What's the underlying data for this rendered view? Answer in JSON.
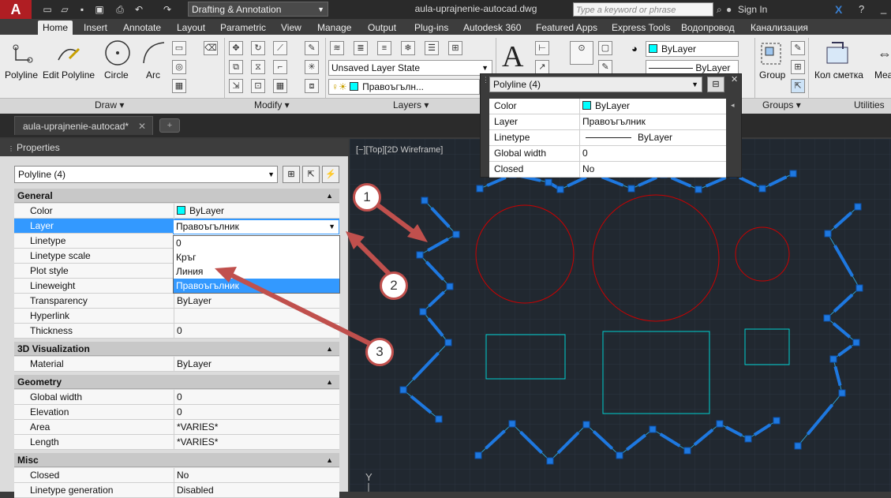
{
  "titlebar": {
    "workspace": "Drafting & Annotation",
    "filename": "aula-uprajnenie-autocad.dwg",
    "search_placeholder": "Type a keyword or phrase",
    "signin": "Sign In"
  },
  "ribbon_tabs": [
    "Home",
    "Insert",
    "Annotate",
    "Layout",
    "Parametric",
    "View",
    "Manage",
    "Output",
    "Plug-ins",
    "Autodesk 360",
    "Featured Apps",
    "Express Tools",
    "Водопровод",
    "Канализация"
  ],
  "ribbon": {
    "draw": {
      "polyline": "Polyline",
      "edit_polyline": "Edit Polyline",
      "circle": "Circle",
      "arc": "Arc",
      "panel": "Draw"
    },
    "modify": {
      "panel": "Modify"
    },
    "layers": {
      "layer_state": "Unsaved Layer State",
      "current_layer": "Правоъгълн...",
      "panel": "Layers"
    },
    "properties": {
      "color": "ByLayer",
      "linetype": "ByLayer"
    },
    "groups": {
      "group": "Group",
      "panel": "Groups"
    },
    "utilities": {
      "kol": "Кол сметка",
      "mea": "Mea",
      "panel": "Utilities"
    }
  },
  "doc_tab": "aula-uprajnenie-autocad*",
  "properties_palette": {
    "title": "Properties",
    "object_select": "Polyline (4)",
    "categories": {
      "general": "General",
      "viz": "3D Visualization",
      "geometry": "Geometry",
      "misc": "Misc"
    },
    "general_rows": [
      {
        "name": "Color",
        "value": "ByLayer"
      },
      {
        "name": "Layer",
        "value": "Правоъгълник"
      },
      {
        "name": "Linetype",
        "value": ""
      },
      {
        "name": "Linetype scale",
        "value": ""
      },
      {
        "name": "Plot style",
        "value": ""
      },
      {
        "name": "Lineweight",
        "value": ""
      },
      {
        "name": "Transparency",
        "value": "ByLayer"
      },
      {
        "name": "Hyperlink",
        "value": ""
      },
      {
        "name": "Thickness",
        "value": "0"
      }
    ],
    "viz_rows": [
      {
        "name": "Material",
        "value": "ByLayer"
      }
    ],
    "geometry_rows": [
      {
        "name": "Global width",
        "value": "0"
      },
      {
        "name": "Elevation",
        "value": "0"
      },
      {
        "name": "Area",
        "value": "*VARIES*"
      },
      {
        "name": "Length",
        "value": "*VARIES*"
      }
    ],
    "misc_rows": [
      {
        "name": "Closed",
        "value": "No"
      },
      {
        "name": "Linetype generation",
        "value": "Disabled"
      }
    ],
    "layer_dropdown": [
      "0",
      "Кръг",
      "Линия",
      "Правоъгълник"
    ]
  },
  "viewport_label": "[−][Top][2D Wireframe]",
  "quick_properties": {
    "object_select": "Polyline (4)",
    "rows": [
      {
        "name": "Color",
        "value": "ByLayer"
      },
      {
        "name": "Layer",
        "value": "Правоъгълник"
      },
      {
        "name": "Linetype",
        "value": "ByLayer"
      },
      {
        "name": "Global width",
        "value": "0"
      },
      {
        "name": "Closed",
        "value": "No"
      }
    ]
  },
  "callouts": [
    "1",
    "2",
    "3"
  ],
  "colors": {
    "accent": "#3399ff",
    "annotation": "#c0504d",
    "cyan": "#00ffff",
    "red_circle": "#cc0000",
    "canvas": "#212830"
  }
}
